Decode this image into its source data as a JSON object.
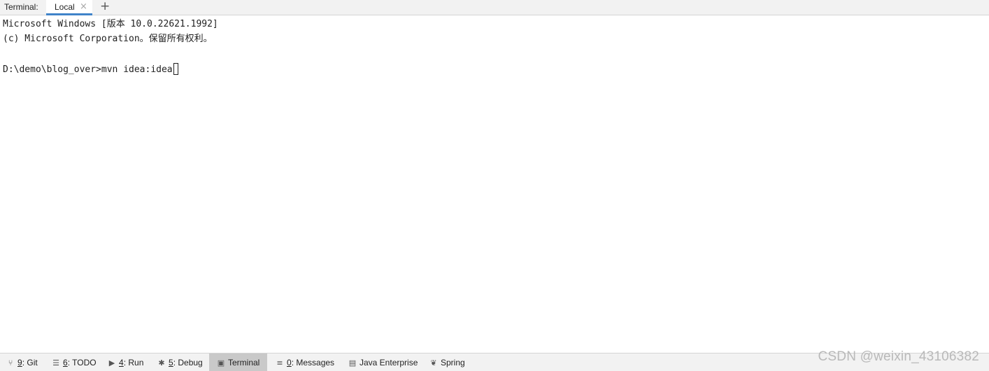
{
  "header": {
    "title": "Terminal:",
    "tabs": [
      {
        "label": "Local",
        "active": true,
        "close_glyph": "×"
      }
    ],
    "new_tab_glyph": "+"
  },
  "terminal": {
    "lines": [
      "Microsoft Windows [版本 10.0.22621.1992]",
      "(c) Microsoft Corporation。保留所有权利。"
    ],
    "prompt": "D:\\demo\\blog_over>",
    "command": "mvn idea:idea"
  },
  "toolbar": {
    "items": [
      {
        "num": "9",
        "label": ": Git",
        "icon": "git-branch-icon",
        "glyph": "⑂"
      },
      {
        "num": "6",
        "label": ": TODO",
        "icon": "list-icon",
        "glyph": "☰"
      },
      {
        "num": "4",
        "label": ": Run",
        "icon": "run-icon",
        "glyph": "▶"
      },
      {
        "num": "5",
        "label": ": Debug",
        "icon": "bug-icon",
        "glyph": "✱"
      },
      {
        "num": "",
        "label": "Terminal",
        "icon": "terminal-icon",
        "glyph": "▣",
        "active": true
      },
      {
        "num": "0",
        "label": ": Messages",
        "icon": "messages-icon",
        "glyph": "≡"
      },
      {
        "num": "",
        "label": "Java Enterprise",
        "icon": "java-enterprise-icon",
        "glyph": "▤"
      },
      {
        "num": "",
        "label": "Spring",
        "icon": "spring-leaf-icon",
        "glyph": "❦"
      }
    ]
  },
  "watermark": "CSDN @weixin_43106382",
  "colors": {
    "accent": "#4083c9",
    "active_tool": "#c9c9c9",
    "bar_bg": "#f2f2f2"
  }
}
